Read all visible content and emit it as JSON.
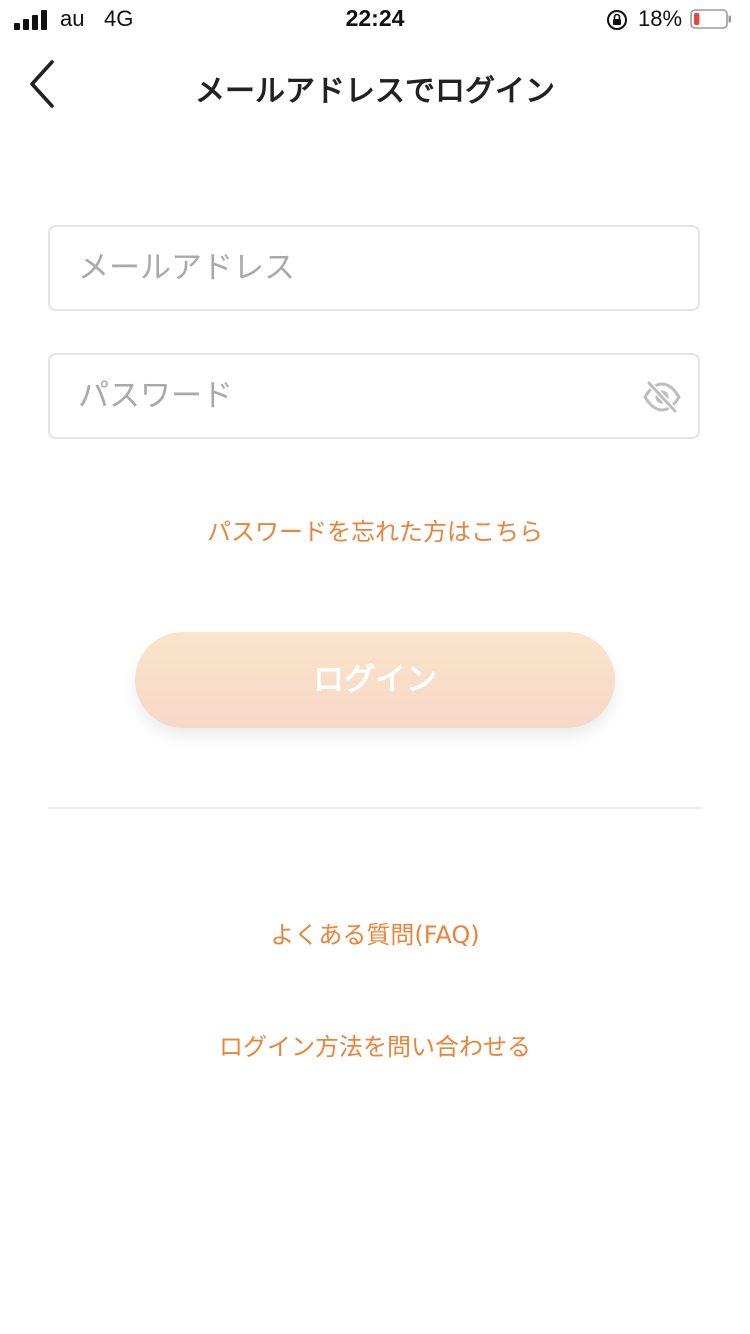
{
  "status_bar": {
    "carrier": "au",
    "network": "4G",
    "time": "22:24",
    "battery_percent": "18%",
    "battery_level": 0.18,
    "battery_color": "#e8453c",
    "icons": [
      "signal-icon",
      "orientation-lock-icon",
      "battery-icon"
    ]
  },
  "header": {
    "title": "メールアドレスでログイン",
    "back_icon": "chevron-left-icon"
  },
  "form": {
    "email_placeholder": "メールアドレス",
    "email_value": "",
    "password_placeholder": "パスワード",
    "password_value": "",
    "password_toggle_icon": "eye-slash-icon",
    "forgot_password": "パスワードを忘れた方はこちら",
    "login_button": "ログイン"
  },
  "footer": {
    "faq": "よくある質問(FAQ)",
    "contact": "ログイン方法を問い合わせる"
  },
  "colors": {
    "accent": "#e9843a",
    "button_gradient_top": "#fbe4c9",
    "button_gradient_bottom": "#f6d8c8",
    "border": "#e3e3e3"
  }
}
